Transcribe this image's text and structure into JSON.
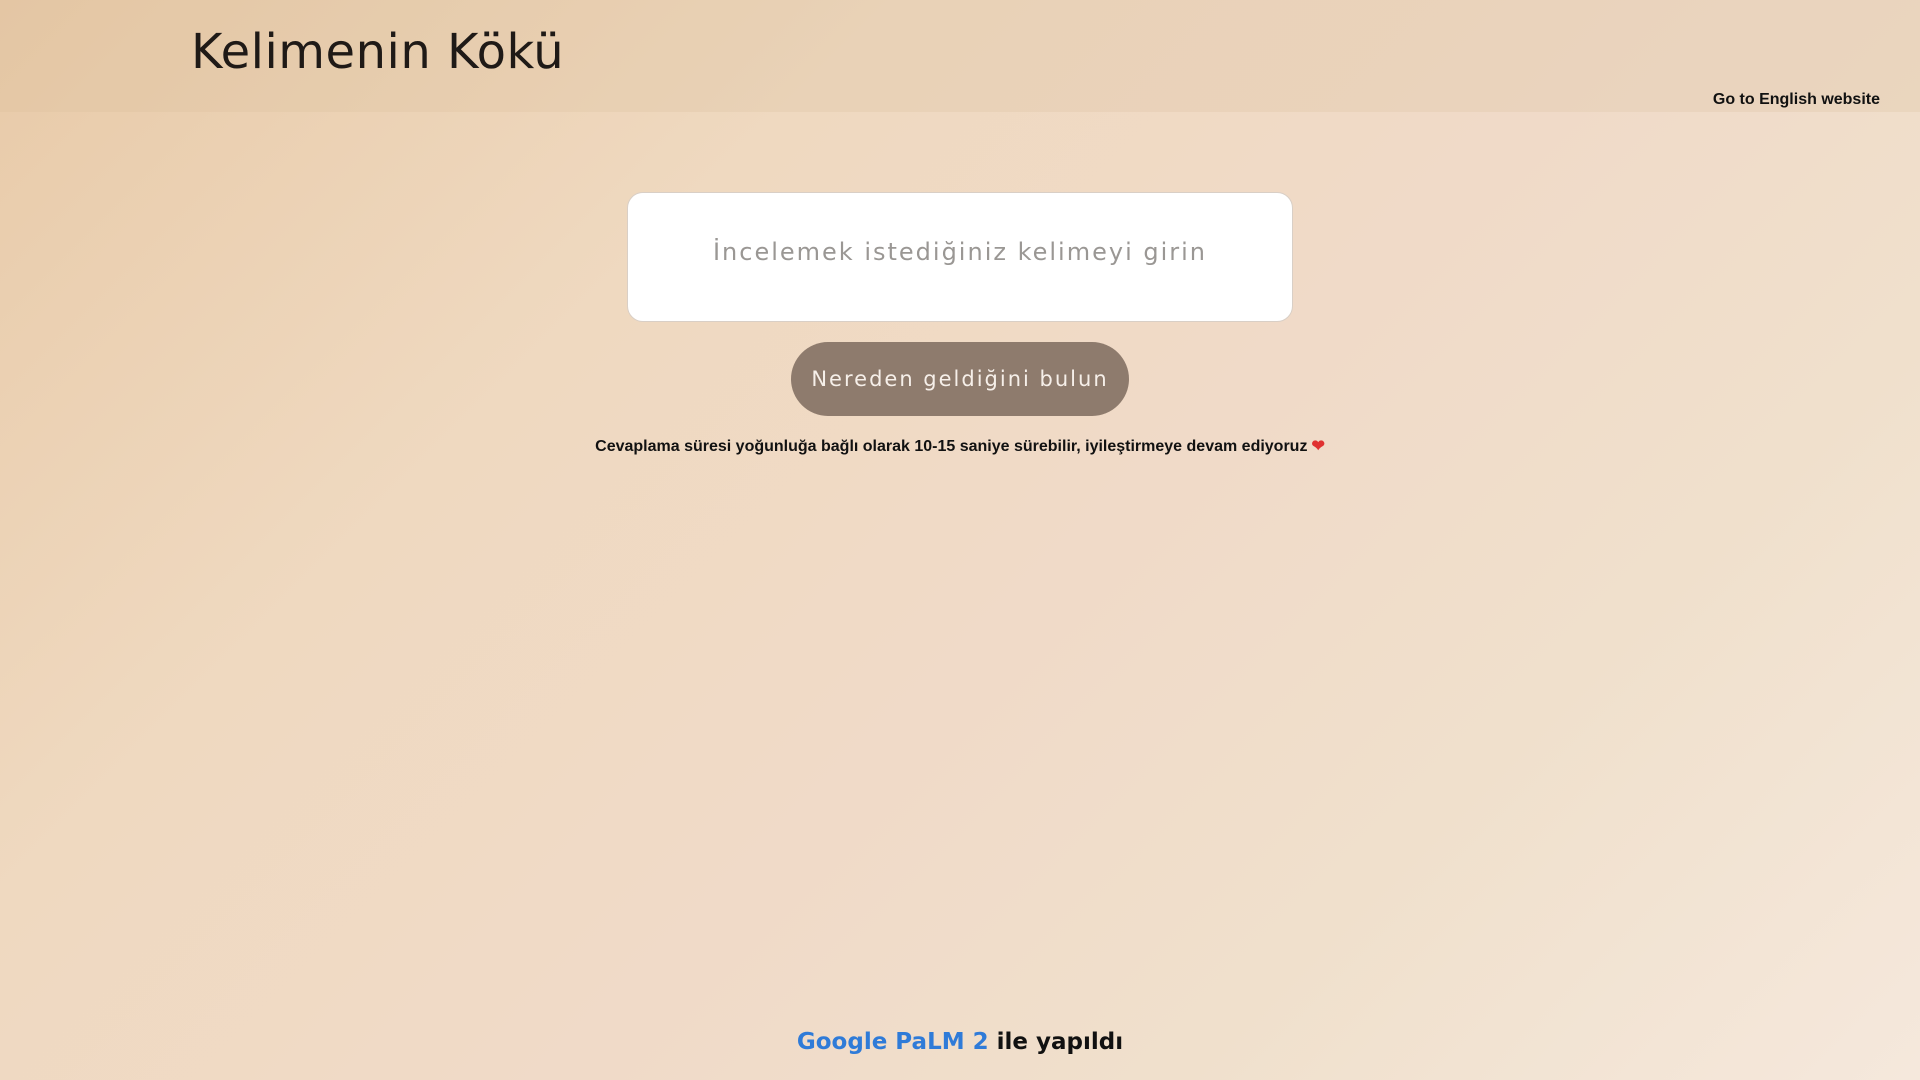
{
  "header": {
    "title": "Kelimenin Kökü",
    "language_link": "Go to English website"
  },
  "search": {
    "placeholder": "İncelemek istediğiniz kelimeyi girin",
    "value": "",
    "button_label": "Nereden geldiğini bulun"
  },
  "notice": {
    "text": "Cevaplama süresi yoğunluğa bağlı olarak 10-15 saniye sürebilir, iyileştirmeye devam ediyoruz",
    "icon": "heart-icon",
    "icon_glyph": "❤"
  },
  "footer": {
    "link_text": "Google PaLM 2",
    "suffix": " ile yapıldı"
  },
  "colors": {
    "accent_blue": "#2f7bd8",
    "button_bg": "#8e7b6d",
    "heart": "#e03131"
  }
}
